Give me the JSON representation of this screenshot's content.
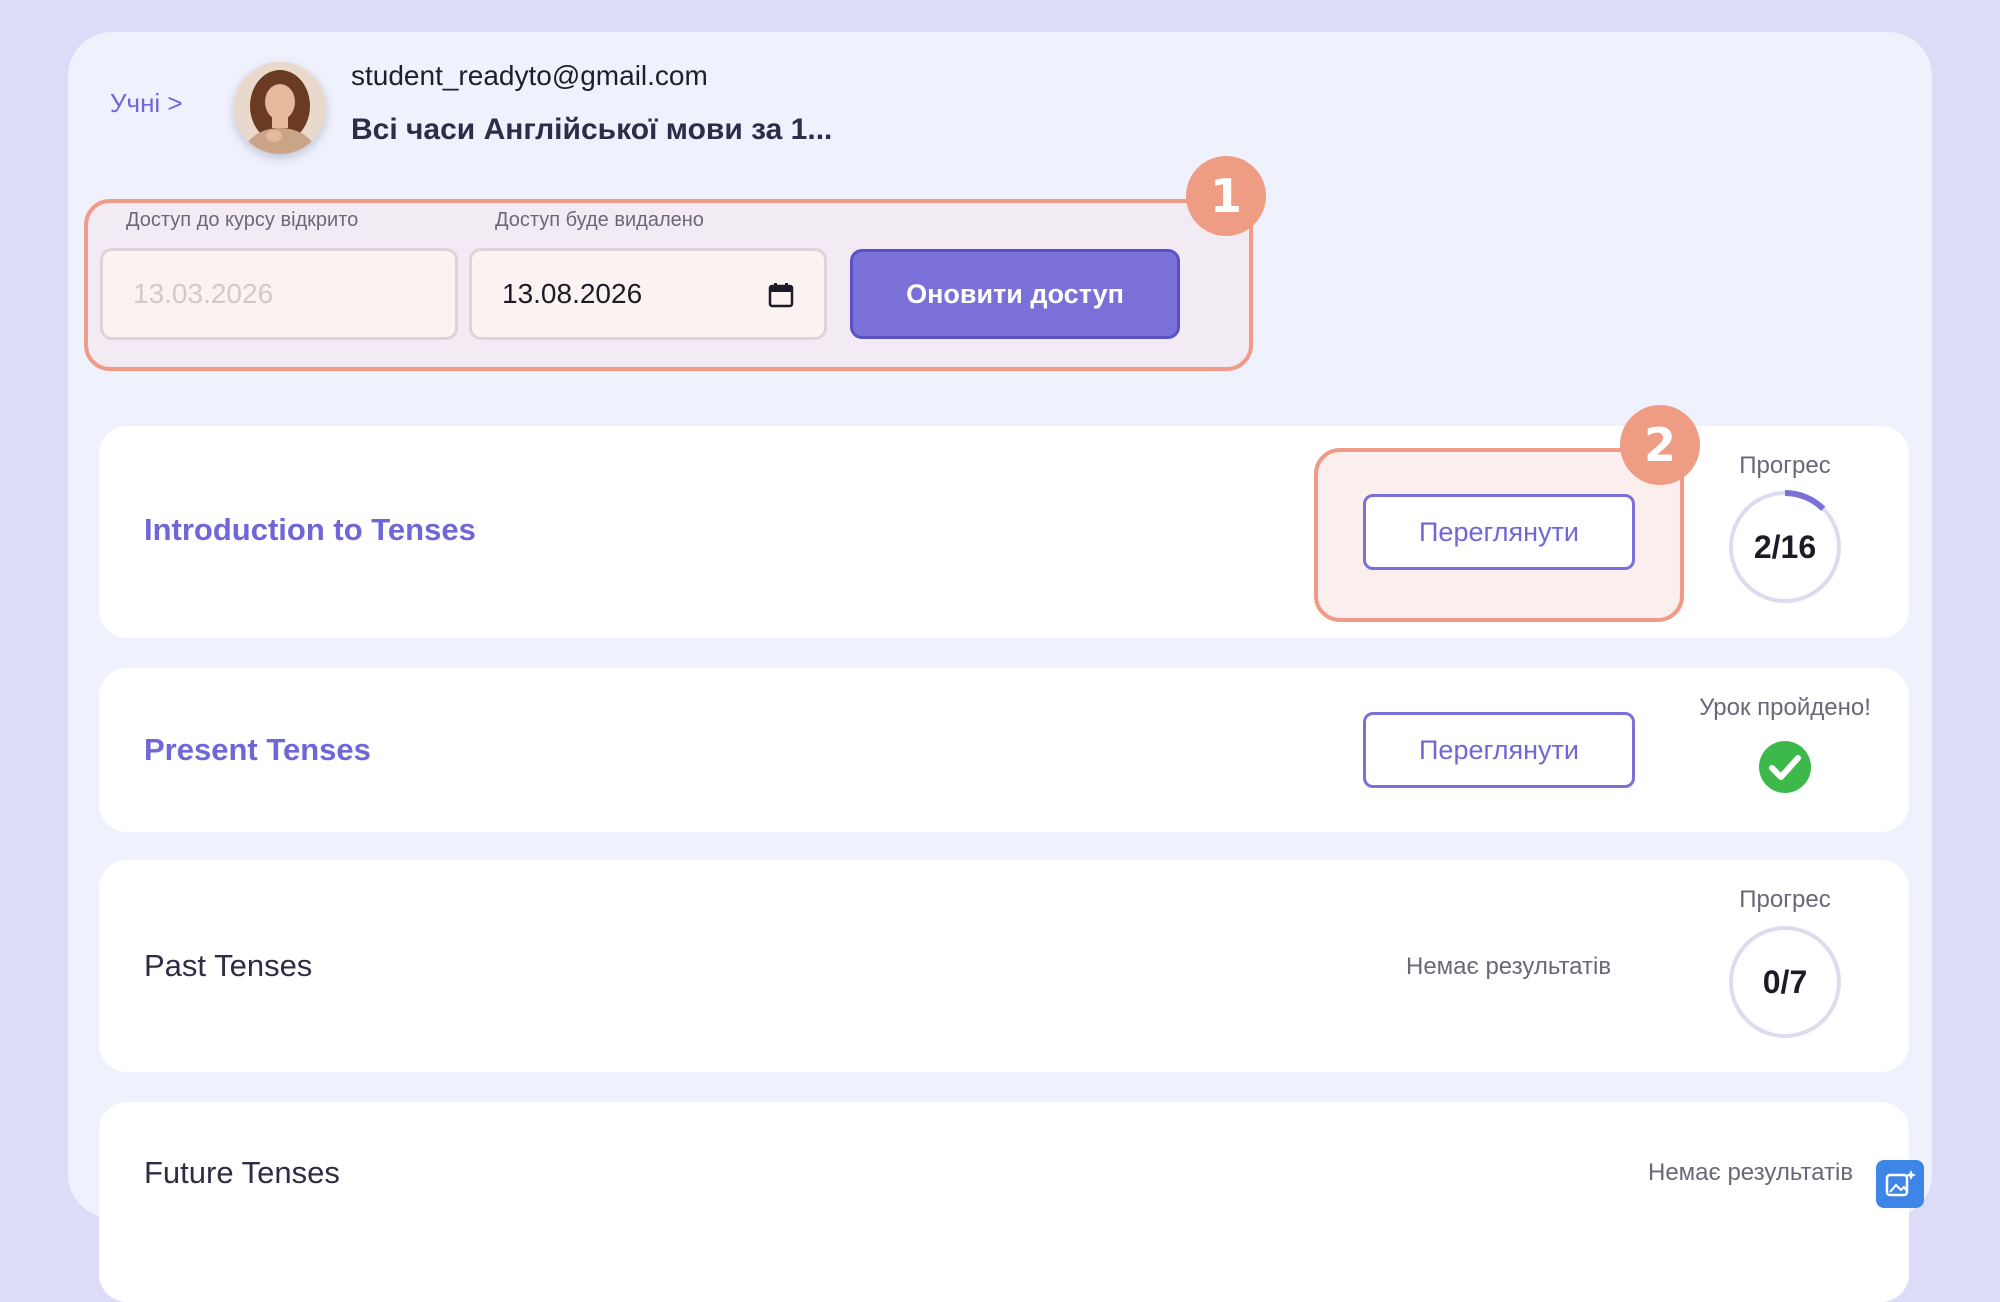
{
  "header": {
    "breadcrumb": "Учні  >",
    "email": "student_readyto@gmail.com",
    "course_title": "Всі часи Англійської мови за 1..."
  },
  "access": {
    "badge": "1",
    "opened_label": "Доступ до курсу відкрито",
    "opened_value": "13.03.2026",
    "removed_label": "Доступ буде видалено",
    "removed_value": "13.08.2026",
    "update_button": "Оновити доступ"
  },
  "lessons": [
    {
      "title": "Introduction to Tenses",
      "button": "Переглянути",
      "badge": "2",
      "status_label": "Прогрес",
      "progress": "2/16",
      "progress_fraction": 0.125
    },
    {
      "title": "Present Tenses",
      "button": "Переглянути",
      "status_label": "Урок пройдено!"
    },
    {
      "title": "Past Tenses",
      "result": "Немає результатів",
      "status_label": "Прогрес",
      "progress": "0/7",
      "progress_fraction": 0
    },
    {
      "title": "Future Tenses",
      "result": "Немає результатів"
    }
  ],
  "colors": {
    "accent": "#7a70d8",
    "highlight": "#ef9c84",
    "success": "#3db84a",
    "page_bg": "#dcdcf8",
    "panel_bg": "#eff1fd"
  },
  "icons": {
    "calendar": "calendar-icon",
    "check": "check-circle-icon",
    "fab": "image-sparkle-icon"
  }
}
